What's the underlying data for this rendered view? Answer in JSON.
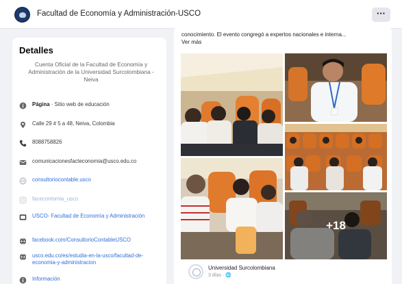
{
  "header": {
    "page_name": "Facultad de Economía y Administración-USCO",
    "more_label": "···"
  },
  "details": {
    "heading": "Detalles",
    "bio": "Cuenta Oficial de la Facultad de Economía y Administración de la Universidad Surcolombiana - Neiva",
    "category_label": "Página",
    "category_value": " · Sitio web de educación",
    "address": "Calle 29 # 5 a 48, Neiva, Colombia",
    "phone": "8088758826",
    "email": "comunicacionesfacteconomia@usco.edu.co",
    "website": "consultoriocontable.usco",
    "instagram": "facecontomia_usco",
    "youtube": "USCO- Facultad de Economía y Administración",
    "facebook": "facebook.com/ConsultorioContableUSCO",
    "link": "usco.edu.co/es/estudia-en-la-usco/facultad-de-economia-y-administracion",
    "more_info": "Información"
  },
  "post": {
    "description": "conocimiento. El evento congregó a expertos nacionales e interna...",
    "see_more": "Ver más",
    "extra_photos": "+18",
    "share_name": "Universidad Surcolombiana",
    "share_meta": "3 días · 🌐"
  },
  "icons": {
    "category": "info-circle-icon",
    "address": "map-pin-icon",
    "phone": "phone-icon",
    "email": "mail-icon",
    "website": "globe-icon",
    "instagram": "instagram-icon",
    "youtube": "youtube-icon",
    "facebook": "globe-icon",
    "link": "globe-icon"
  },
  "colors": {
    "link": "#2e6fd8",
    "brand": "#1b3a6b",
    "background": "#f0f2f5"
  }
}
